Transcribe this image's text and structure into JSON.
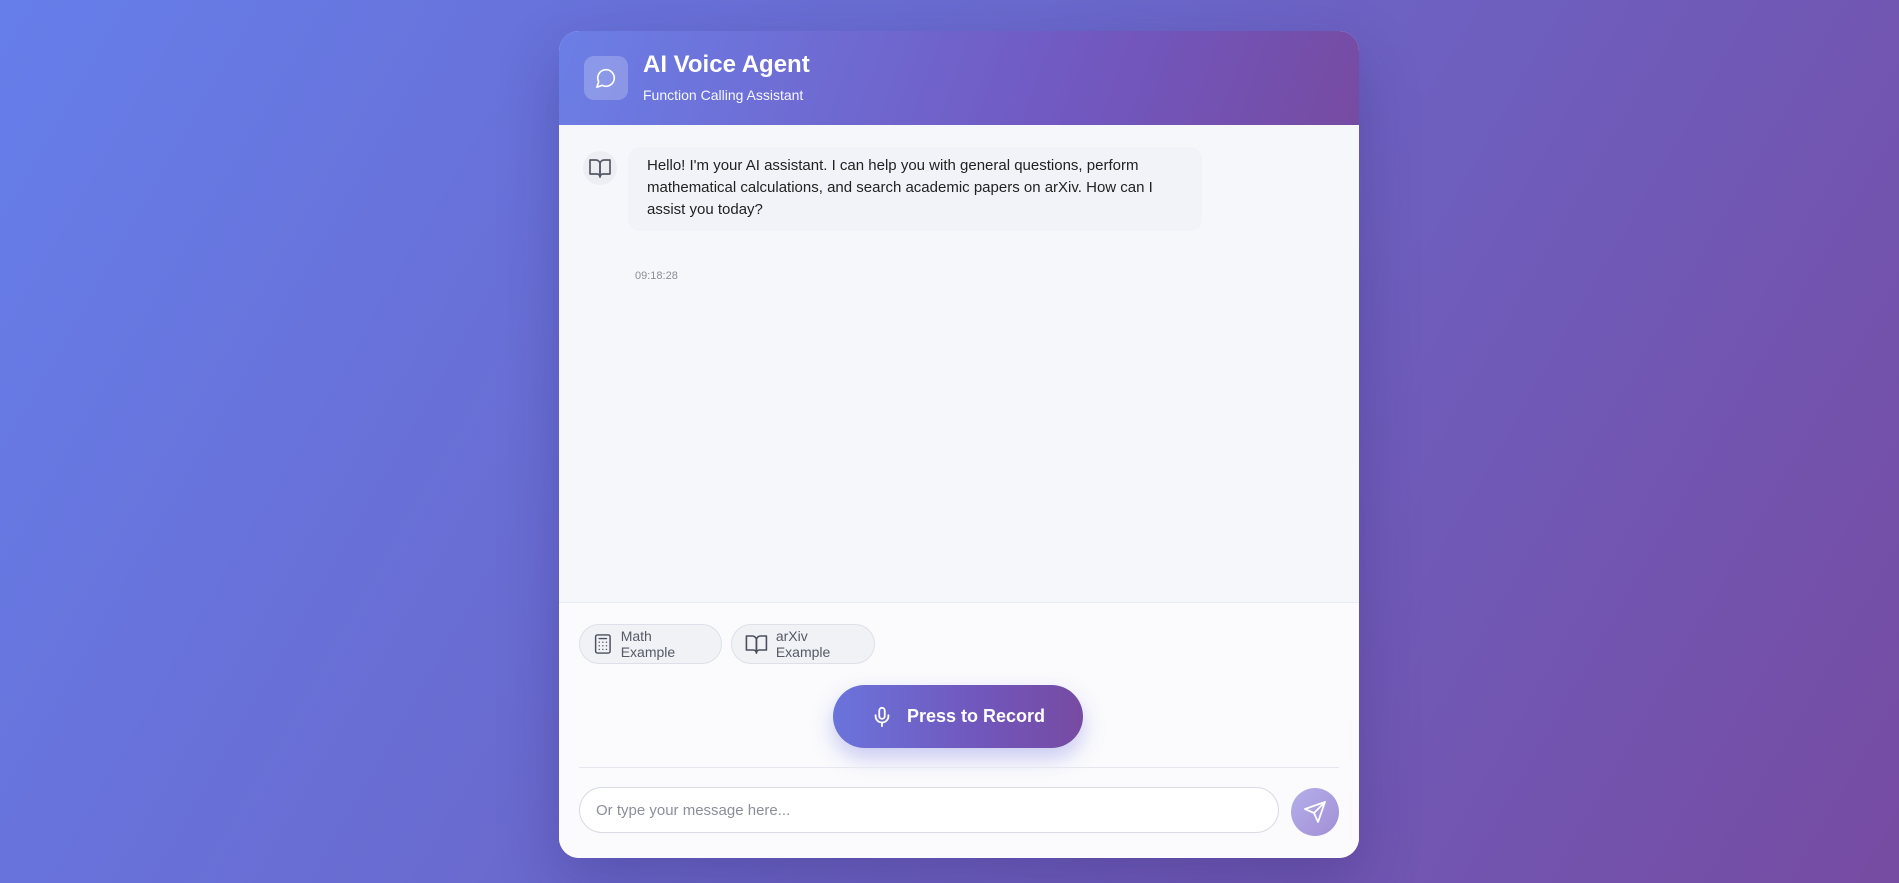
{
  "header": {
    "title": "AI Voice Agent",
    "subtitle": "Function Calling Assistant",
    "icon": "chat-bubble-icon"
  },
  "messages": [
    {
      "sender": "assistant",
      "avatar_icon": "book-icon",
      "text": "Hello! I'm your AI assistant. I can help you with general questions, perform mathematical calculations, and search academic papers on arXiv. How can I assist you today?",
      "time": "09:18:28"
    }
  ],
  "quick_actions": [
    {
      "label": "Math Example",
      "icon": "calculator-icon"
    },
    {
      "label": "arXiv Example",
      "icon": "book-icon"
    }
  ],
  "record_button": {
    "label": "Press to Record",
    "icon": "microphone-icon"
  },
  "input": {
    "placeholder": "Or type your message here...",
    "value": ""
  },
  "send_button": {
    "icon": "send-icon"
  },
  "colors": {
    "gradient_start": "#667eea",
    "gradient_end": "#764ba2",
    "panel_background": "#f6f7fb"
  }
}
